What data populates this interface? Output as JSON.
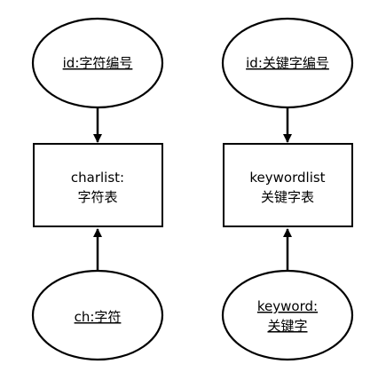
{
  "diagram": {
    "left": {
      "top_ellipse": "id:字符编号",
      "box_line1": "charlist:",
      "box_line2": "字符表",
      "bottom_ellipse": "ch:字符"
    },
    "right": {
      "top_ellipse": "id:关键字编号",
      "box_line1": "keywordlist",
      "box_line2": "关键字表",
      "bottom_ellipse_line1": "keyword:",
      "bottom_ellipse_line2": "关键字"
    }
  }
}
